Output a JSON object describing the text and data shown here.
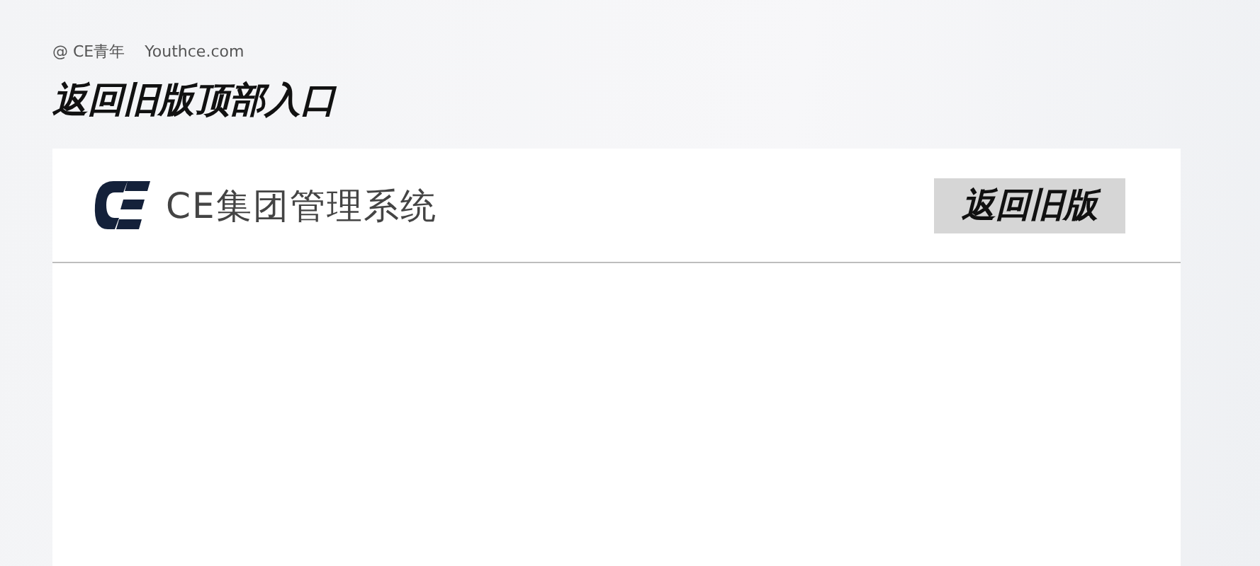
{
  "credit": {
    "author": "@ CE青年",
    "site": "Youthce.com"
  },
  "heading": "返回旧版顶部入口",
  "app": {
    "title": "CE集团管理系统",
    "button": "返回旧版"
  }
}
